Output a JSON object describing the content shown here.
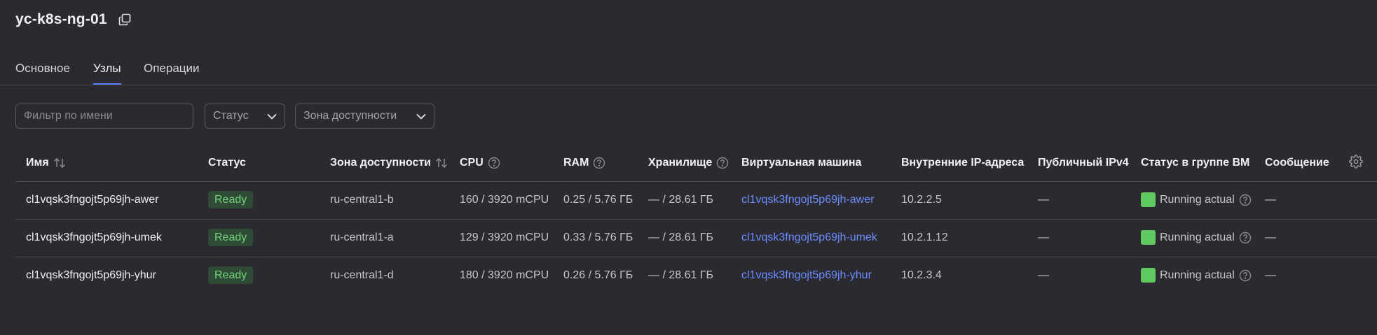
{
  "header": {
    "title": "yc-k8s-ng-01",
    "copy_icon": "copy-icon"
  },
  "tabs": [
    {
      "label": "Основное",
      "active": false
    },
    {
      "label": "Узлы",
      "active": true
    },
    {
      "label": "Операции",
      "active": false
    }
  ],
  "filters": {
    "name_placeholder": "Фильтр по имени",
    "status_label": "Статус",
    "zone_label": "Зона доступности"
  },
  "table": {
    "columns": {
      "name": "Имя",
      "status": "Статус",
      "zone": "Зона доступности",
      "cpu": "CPU",
      "ram": "RAM",
      "storage": "Хранилище",
      "vm": "Виртуальная машина",
      "ip": "Внутренние IP-адреса",
      "public_ip": "Публичный IPv4",
      "vm_status": "Статус в группе ВМ",
      "message": "Сообщение"
    },
    "rows": [
      {
        "name": "cl1vqsk3fngojt5p69jh-awer",
        "status": "Ready",
        "zone": "ru-central1-b",
        "cpu": "160 / 3920 mCPU",
        "ram": "0.25 / 5.76 ГБ",
        "storage": "— / 28.61 ГБ",
        "vm": "cl1vqsk3fngojt5p69jh-awer",
        "ip": "10.2.2.5",
        "public_ip": "—",
        "vm_status": "Running actual",
        "message": "—"
      },
      {
        "name": "cl1vqsk3fngojt5p69jh-umek",
        "status": "Ready",
        "zone": "ru-central1-a",
        "cpu": "129 / 3920 mCPU",
        "ram": "0.33 / 5.76 ГБ",
        "storage": "— / 28.61 ГБ",
        "vm": "cl1vqsk3fngojt5p69jh-umek",
        "ip": "10.2.1.12",
        "public_ip": "—",
        "vm_status": "Running actual",
        "message": "—"
      },
      {
        "name": "cl1vqsk3fngojt5p69jh-yhur",
        "status": "Ready",
        "zone": "ru-central1-d",
        "cpu": "180 / 3920 mCPU",
        "ram": "0.26 / 5.76 ГБ",
        "storage": "— / 28.61 ГБ",
        "vm": "cl1vqsk3fngojt5p69jh-yhur",
        "ip": "10.2.3.4",
        "public_ip": "—",
        "vm_status": "Running actual",
        "message": "—"
      }
    ]
  },
  "colors": {
    "background": "#2b2a30",
    "accent": "#5b7fff",
    "link": "#6b8dff",
    "ready_badge": "#2f4a35",
    "ready_text": "#6fd37a",
    "running": "#5fc95f"
  }
}
